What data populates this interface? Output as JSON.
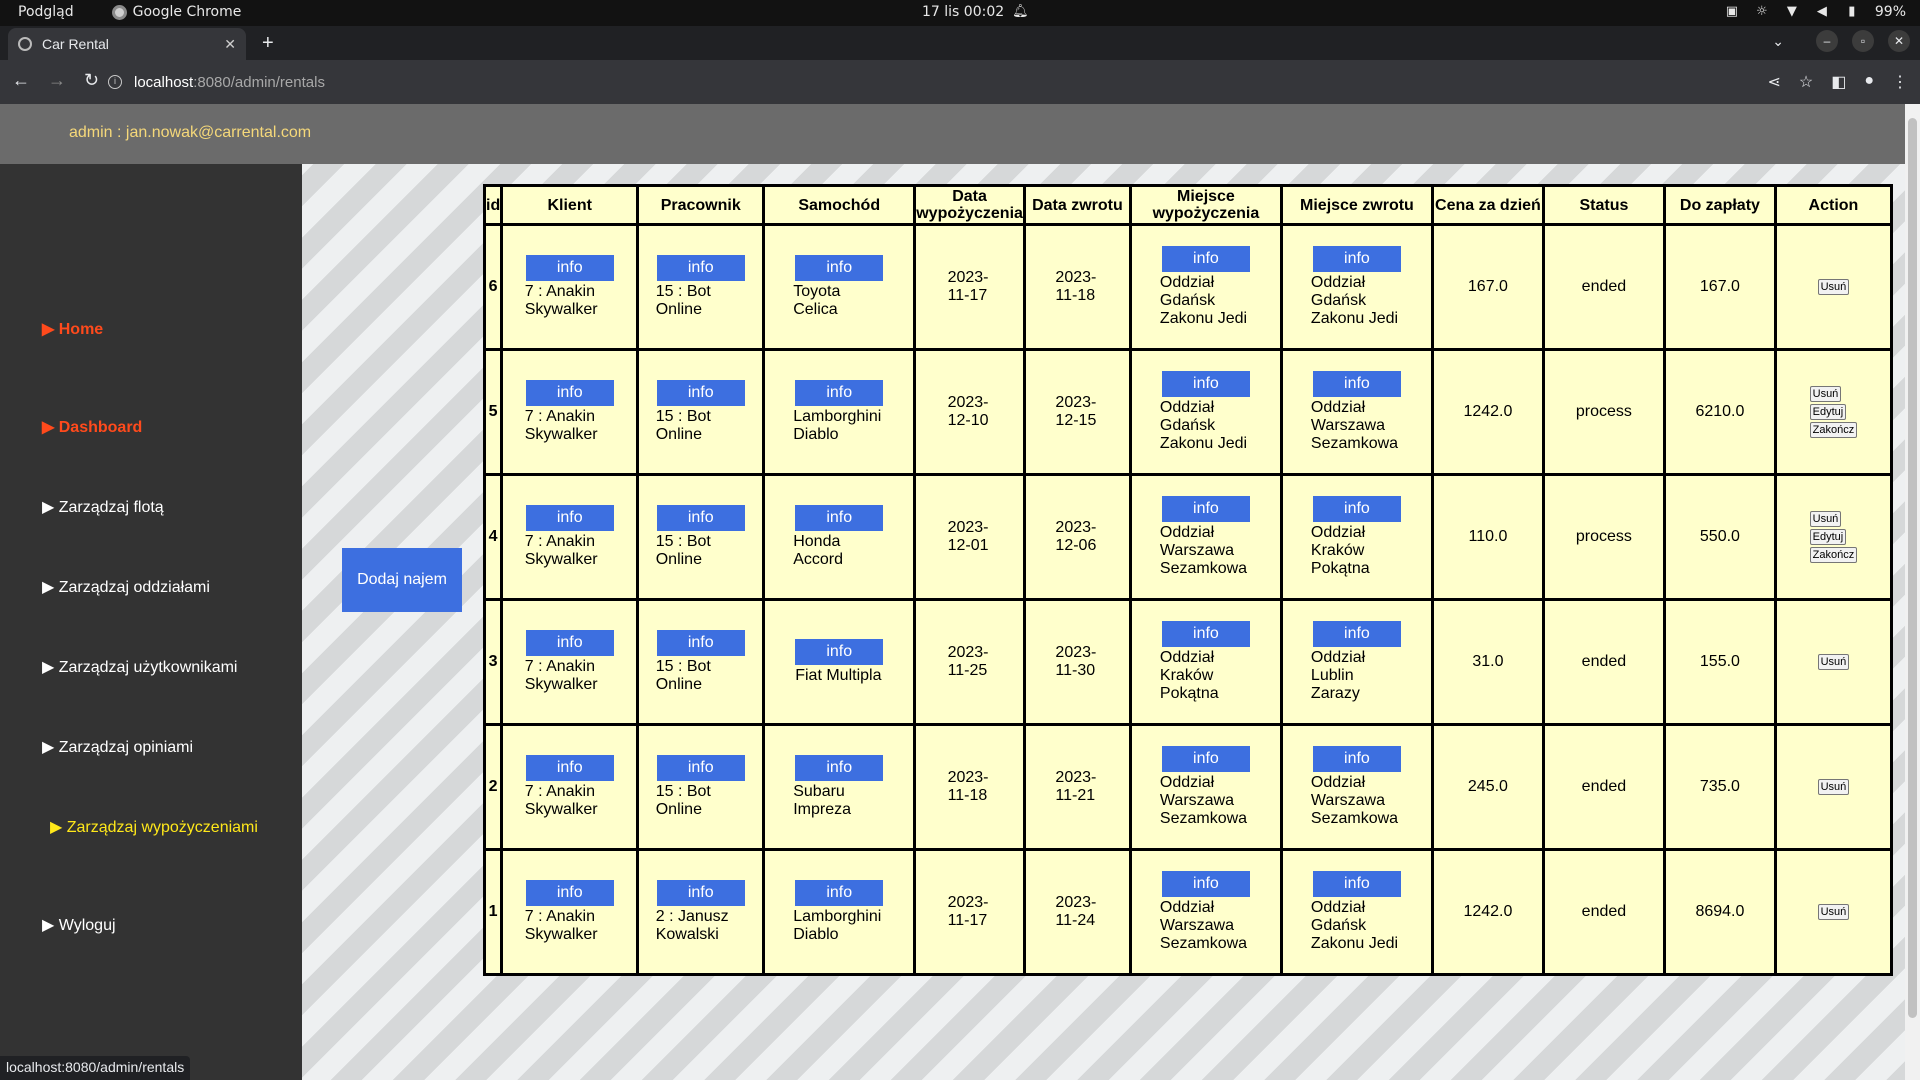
{
  "os": {
    "app": "Podgląd",
    "browser": "Google Chrome",
    "datetime": "17 lis  00:02",
    "battery": "99%"
  },
  "browser": {
    "tab_title": "Car Rental",
    "url_host": "localhost",
    "url_path": ":8080/admin/rentals",
    "status_url": "localhost:8080/admin/rentals"
  },
  "header": {
    "user": "admin : jan.nowak@carrental.com"
  },
  "sidebar": {
    "items": [
      {
        "label": "▶ Home"
      },
      {
        "label": "▶ Dashboard"
      },
      {
        "label": "▶ Zarządzaj flotą"
      },
      {
        "label": "▶ Zarządzaj oddziałami"
      },
      {
        "label": "▶ Zarządzaj użytkownikami"
      },
      {
        "label": "▶ Zarządzaj opiniami"
      },
      {
        "label": "▶ Zarządzaj wypożyczeniami"
      },
      {
        "label": "▶ Wyloguj"
      }
    ]
  },
  "add_button": "Dodaj najem",
  "info_label": "info",
  "columns": [
    "id",
    "Klient",
    "Pracownik",
    "Samochód",
    "Data wypożyczenia",
    "Data zwrotu",
    "Miejsce wypożyczenia",
    "Miejsce zwrotu",
    "Cena za dzień",
    "Status",
    "Do zapłaty",
    "Action"
  ],
  "actions": {
    "delete": "Usuń",
    "edit": "Edytuj",
    "finish": "Zakończ"
  },
  "rows": [
    {
      "id": "6",
      "client": "7 : Anakin Skywalker",
      "employee": "15 : Bot Online",
      "car": "Toyota Celica",
      "date_from": "2023-11-17",
      "date_to": "2023-11-18",
      "place_from": "Oddział Gdańsk Zakonu Jedi",
      "place_to": "Oddział Gdańsk Zakonu Jedi",
      "price": "167.0",
      "status": "ended",
      "total": "167.0"
    },
    {
      "id": "5",
      "client": "7 : Anakin Skywalker",
      "employee": "15 : Bot Online",
      "car": "Lamborghini Diablo",
      "date_from": "2023-12-10",
      "date_to": "2023-12-15",
      "place_from": "Oddział Gdańsk Zakonu Jedi",
      "place_to": "Oddział Warszawa Sezamkowa",
      "price": "1242.0",
      "status": "process",
      "total": "6210.0"
    },
    {
      "id": "4",
      "client": "7 : Anakin Skywalker",
      "employee": "15 : Bot Online",
      "car": "Honda Accord",
      "date_from": "2023-12-01",
      "date_to": "2023-12-06",
      "place_from": "Oddział Warszawa Sezamkowa",
      "place_to": "Oddział Kraków Pokątna",
      "price": "110.0",
      "status": "process",
      "total": "550.0"
    },
    {
      "id": "3",
      "client": "7 : Anakin Skywalker",
      "employee": "15 : Bot Online",
      "car": "Fiat Multipla",
      "date_from": "2023-11-25",
      "date_to": "2023-11-30",
      "place_from": "Oddział Kraków Pokątna",
      "place_to": "Oddział Lublin Zarazy",
      "price": "31.0",
      "status": "ended",
      "total": "155.0"
    },
    {
      "id": "2",
      "client": "7 : Anakin Skywalker",
      "employee": "15 : Bot Online",
      "car": "Subaru Impreza",
      "date_from": "2023-11-18",
      "date_to": "2023-11-21",
      "place_from": "Oddział Warszawa Sezamkowa",
      "place_to": "Oddział Warszawa Sezamkowa",
      "price": "245.0",
      "status": "ended",
      "total": "735.0"
    },
    {
      "id": "1",
      "client": "7 : Anakin Skywalker",
      "employee": "2 : Janusz Kowalski",
      "car": "Lamborghini Diablo",
      "date_from": "2023-11-17",
      "date_to": "2023-11-24",
      "place_from": "Oddział Warszawa Sezamkowa",
      "place_to": "Oddział Gdańsk Zakonu Jedi",
      "price": "1242.0",
      "status": "ended",
      "total": "8694.0"
    }
  ]
}
